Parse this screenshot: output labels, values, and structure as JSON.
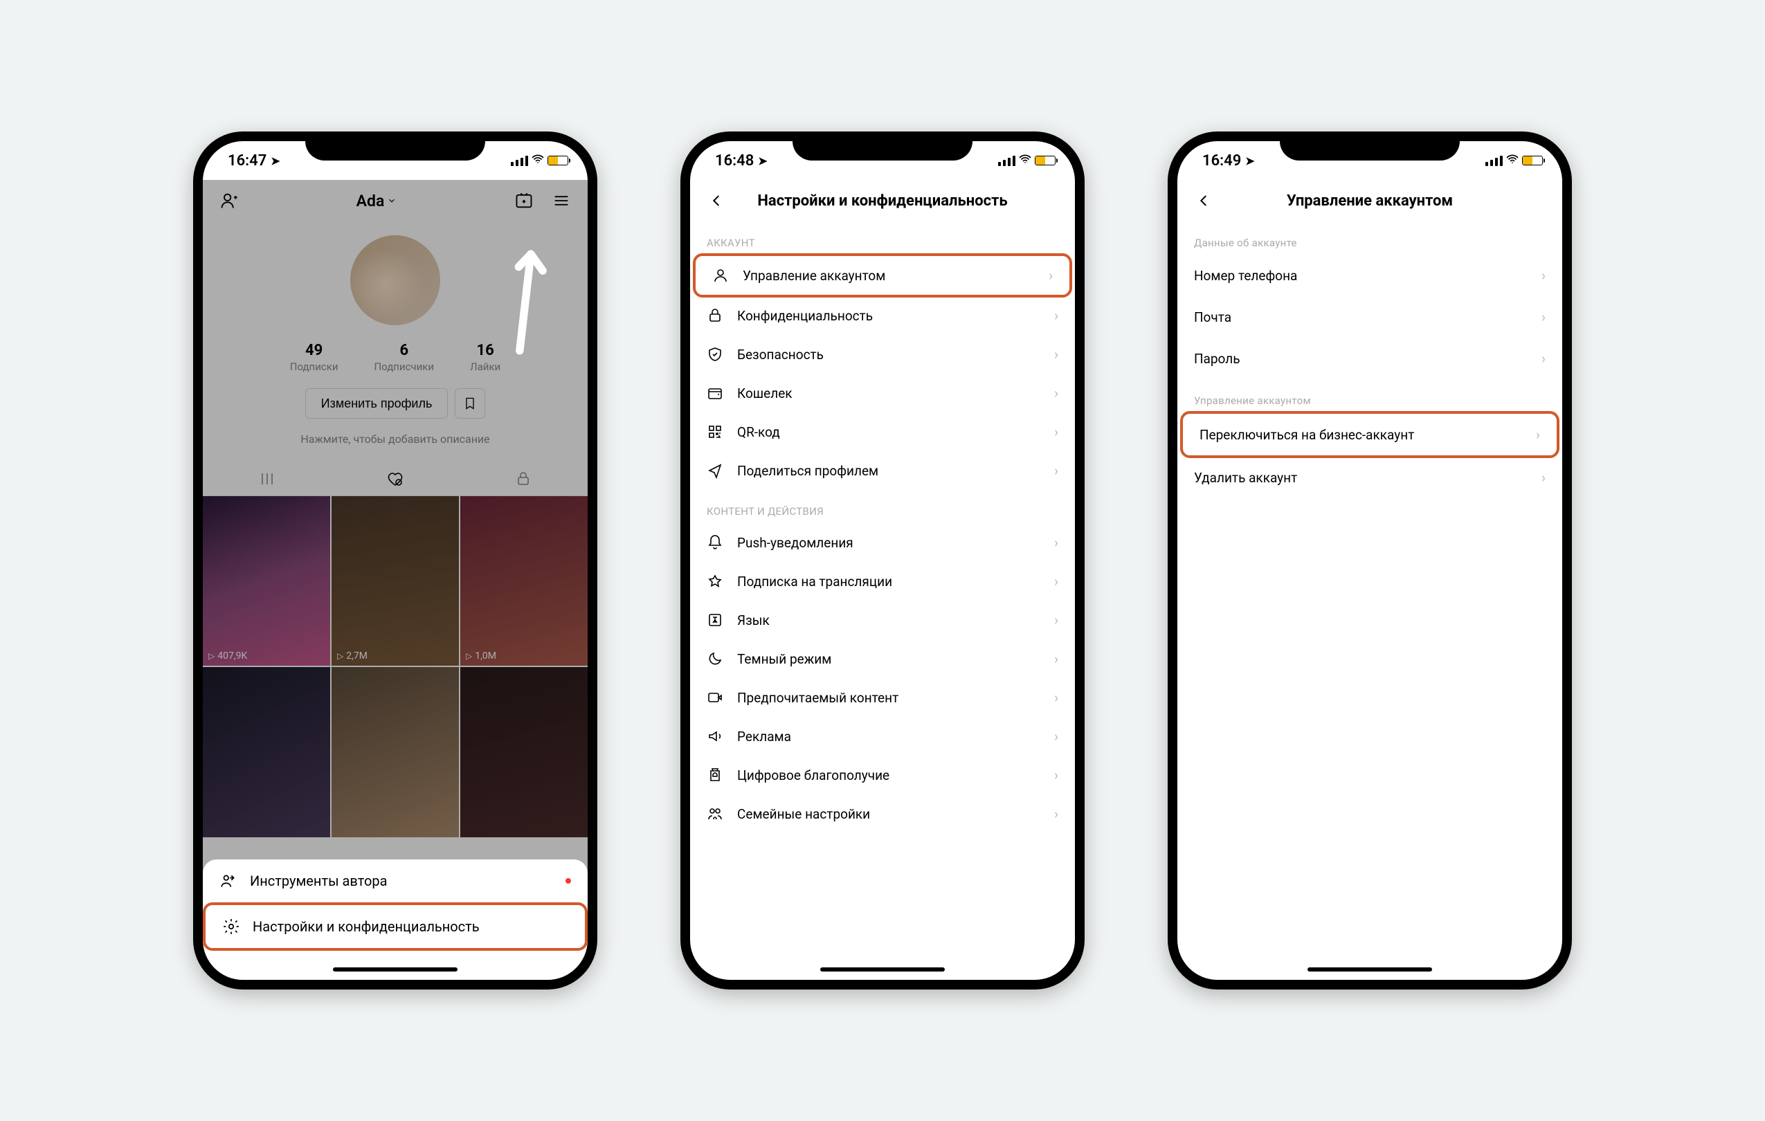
{
  "phone1": {
    "time": "16:47",
    "username": "Ada",
    "stats": {
      "following_count": "49",
      "following_label": "Подписки",
      "followers_count": "6",
      "followers_label": "Подписчики",
      "likes_count": "16",
      "likes_label": "Лайки"
    },
    "edit_profile": "Изменить профиль",
    "add_bio": "Нажмите, чтобы добавить описание",
    "thumb_views": [
      "407,9K",
      "2,7M",
      "1,0M"
    ],
    "sheet": {
      "creator_tools": "Инструменты автора",
      "settings": "Настройки и конфиденциальность"
    }
  },
  "phone2": {
    "time": "16:48",
    "title": "Настройки и конфиденциальность",
    "section_account": "АККАУНТ",
    "rows_account": [
      "Управление аккаунтом",
      "Конфиденциальность",
      "Безопасность",
      "Кошелек",
      "QR-код",
      "Поделиться профилем"
    ],
    "section_content": "КОНТЕНТ И ДЕЙСТВИЯ",
    "rows_content": [
      "Push-уведомления",
      "Подписка на трансляции",
      "Язык",
      "Темный режим",
      "Предпочитаемый контент",
      "Реклама",
      "Цифровое благополучие",
      "Семейные настройки"
    ]
  },
  "phone3": {
    "time": "16:49",
    "title": "Управление аккаунтом",
    "section_info": "Данные об аккаунте",
    "rows_info": [
      "Номер телефона",
      "Почта",
      "Пароль"
    ],
    "section_manage": "Управление аккаунтом",
    "rows_manage": [
      "Переключиться на бизнес-аккаунт",
      "Удалить аккаунт"
    ]
  }
}
